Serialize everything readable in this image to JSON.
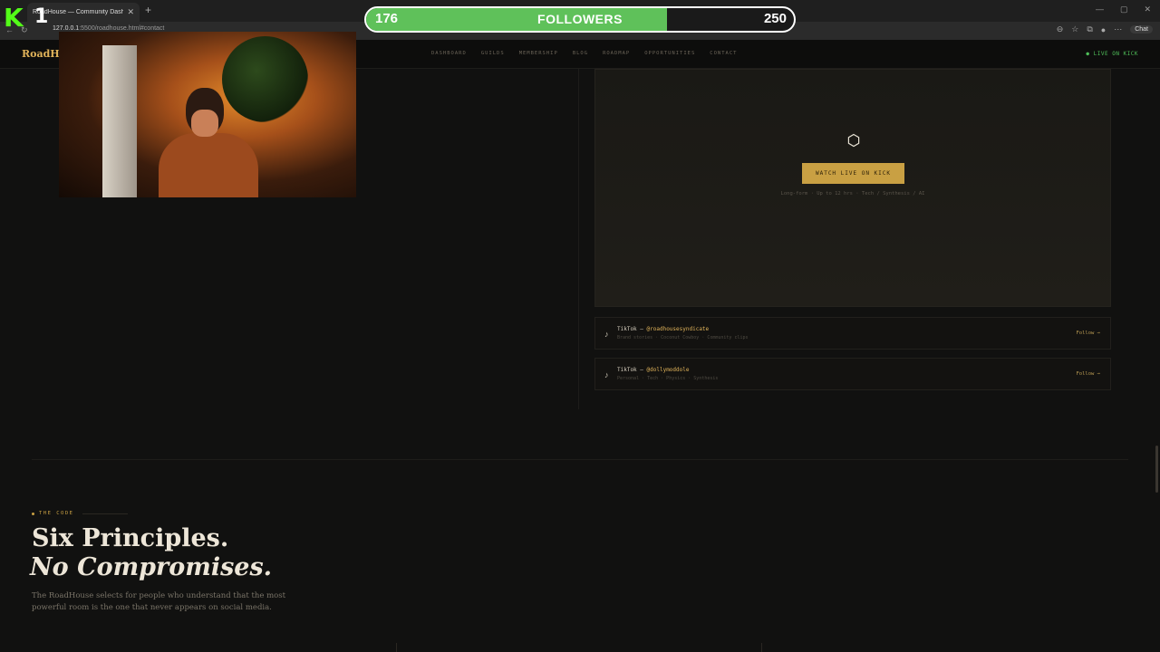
{
  "browser": {
    "tab_title": "RoadHouse — Community Dashb",
    "url_host": "127.0.0.1",
    "url_rest": ":5500/roadhouse.html#contact"
  },
  "site": {
    "logo": "RoadHo",
    "nav": [
      "DASHBOARD",
      "GUILDS",
      "MEMBERSHIP",
      "BLOG",
      "ROADMAP",
      "OPPORTUNITIES",
      "CONTACT"
    ],
    "live_badge": "● LIVE ON KICK"
  },
  "overlay": {
    "kick_logo": "K",
    "kick_count": "1",
    "goal_current": "176",
    "goal_label": "FOLLOWERS",
    "goal_target": "250",
    "goal_progress": 0.704,
    "goal_color": "#5fc15a"
  },
  "player": {
    "button": "WATCH LIVE ON KICK",
    "meta": "Long-form · Up to 12 hrs · Tech / Synthesis / AI"
  },
  "tiktok": [
    {
      "title_prefix": "TikTok — ",
      "handle": "@roadhousesyndicate",
      "sub": "Brand stories · Coconut Cowboy · Community clips",
      "follow": "Follow →"
    },
    {
      "title_prefix": "TikTok — ",
      "handle": "@dollymoddole",
      "sub": "Personal · Tech · Physics · Synthesis",
      "follow": "Follow →"
    }
  ],
  "code_section": {
    "eyebrow": "THE CODE",
    "heading_1": "Six Principles.",
    "heading_2": "No Compromises.",
    "lede": "The RoadHouse selects for people who understand that the most powerful room is the one that never appears on social media."
  },
  "colors": {
    "accent": "#c9a043",
    "live": "#4fbf59",
    "kick": "#53fc18"
  }
}
